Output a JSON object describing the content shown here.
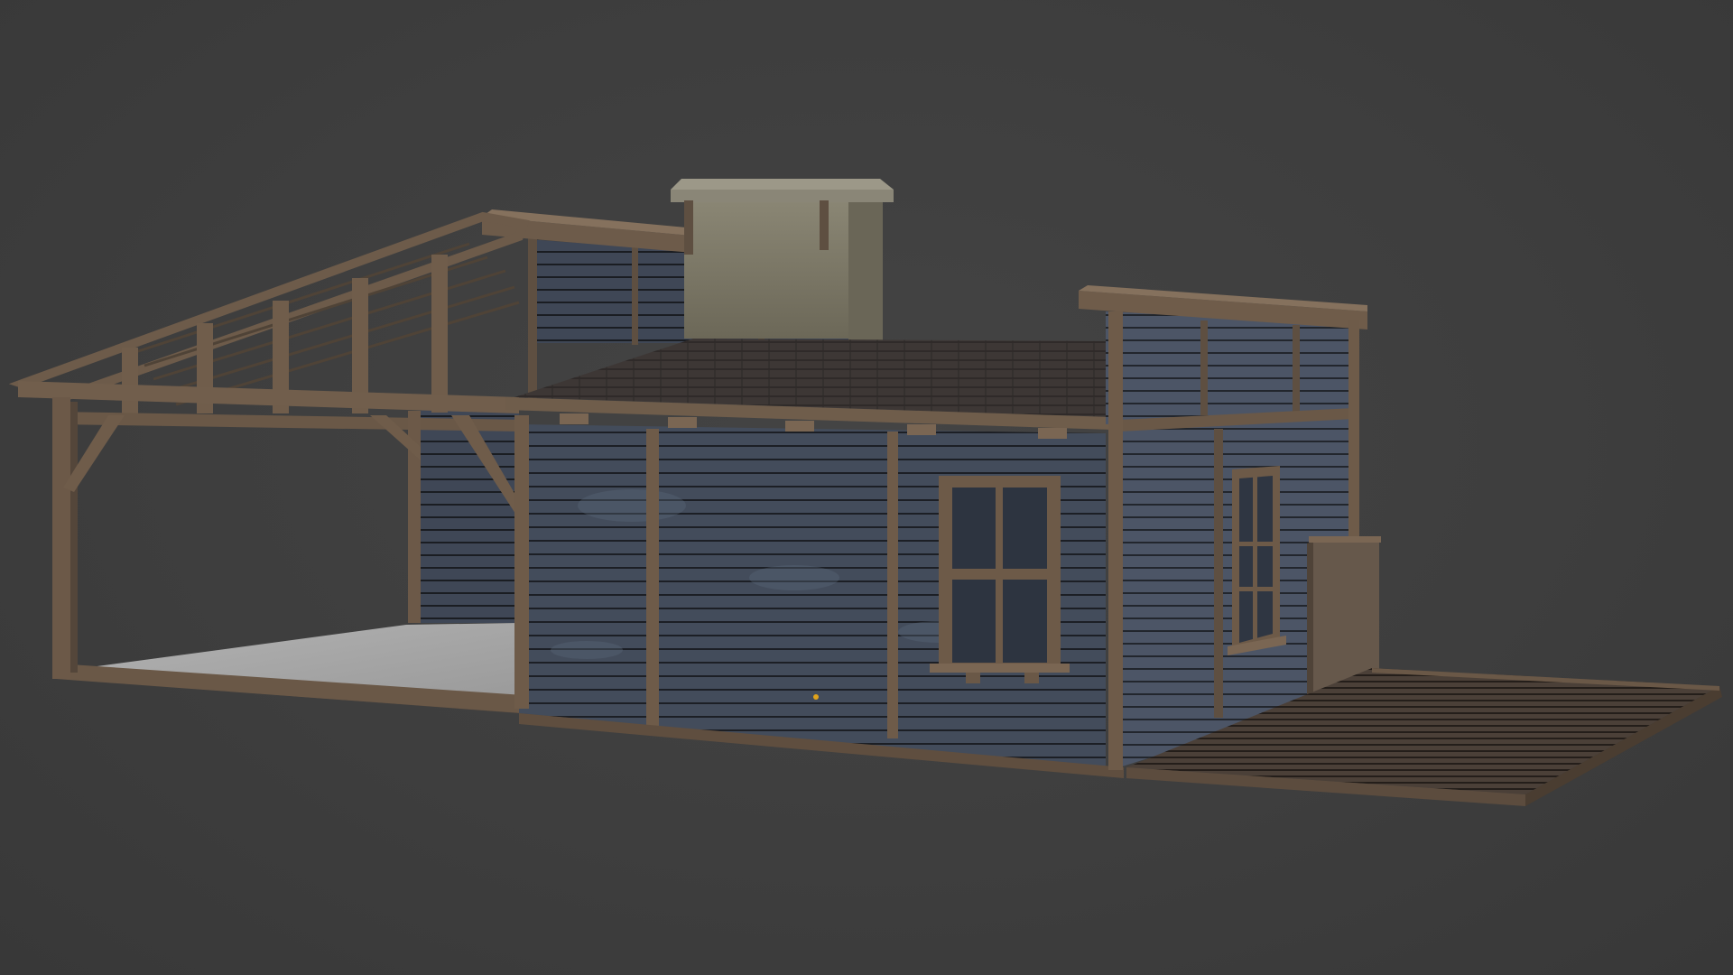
{
  "viewport": {
    "background": "#3d3d3d"
  },
  "model": {
    "subject": "wooden-shed-3d-model",
    "colors": {
      "siding_dark": "#3f4856",
      "siding_light": "#4d5768",
      "plank_gap": "#1c1f25",
      "timber": "#6a5847",
      "timber_dark": "#4a3d31",
      "timber_light": "#7f6b57",
      "roof_shingle": "#3b3634",
      "concrete": "#a9a9a9",
      "chimney_stone": "#7c7868",
      "deck": "#4a3f36",
      "origin_marker": "#e0a21a"
    }
  }
}
